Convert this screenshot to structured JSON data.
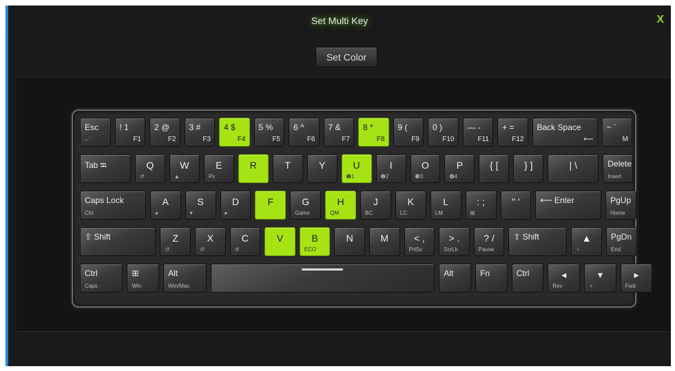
{
  "window": {
    "title": "Set Multi Key",
    "close_label": "X",
    "set_color_label": "Set Color"
  },
  "colors": {
    "accent_green": "#a6e315",
    "window_border_blue": "#1f86d6"
  },
  "keyboard": {
    "rows": [
      [
        {
          "main": "Esc",
          "alt": "~ `"
        },
        {
          "main": "! 1",
          "sub": "F1"
        },
        {
          "main": "2 @",
          "sub": "F2"
        },
        {
          "main": "3 #",
          "sub": "F3"
        },
        {
          "main": "4 $",
          "sub": "F4",
          "lit": true
        },
        {
          "main": "5 %",
          "sub": "F5"
        },
        {
          "main": "6 ^",
          "sub": "F6"
        },
        {
          "main": "7 &",
          "sub": "F7"
        },
        {
          "main": "8 *",
          "sub": "F8",
          "lit": true
        },
        {
          "main": "9 (",
          "sub": "F9"
        },
        {
          "main": "0 )",
          "sub": "F10"
        },
        {
          "main": "— -",
          "sub": "F11"
        },
        {
          "main": "+ =",
          "sub": "F12"
        },
        {
          "main": "Back Space",
          "sub": "⟵",
          "wide": 2
        },
        {
          "main": "~ `",
          "sub": "M"
        }
      ],
      [
        {
          "main": "Tab ⭾",
          "wide": 1.6
        },
        {
          "center": "Q",
          "alt": "↺"
        },
        {
          "center": "W",
          "alt": "▲"
        },
        {
          "center": "E",
          "alt": "Px"
        },
        {
          "center": "R",
          "lit": true
        },
        {
          "center": "T"
        },
        {
          "center": "Y"
        },
        {
          "center": "U",
          "alt": "❶1",
          "lit": true
        },
        {
          "center": "I",
          "alt": "❷2"
        },
        {
          "center": "O",
          "alt": "❸3"
        },
        {
          "center": "P",
          "alt": "❹4"
        },
        {
          "center": "{ ["
        },
        {
          "center": "} ]"
        },
        {
          "center": "| \\",
          "wide": 1.6
        },
        {
          "main": "Delete",
          "alt": "Insert"
        }
      ],
      [
        {
          "main": "Caps Lock",
          "alt": "Ctrl",
          "wide": 2
        },
        {
          "center": "A",
          "alt": "◂"
        },
        {
          "center": "S",
          "alt": "▾"
        },
        {
          "center": "D",
          "alt": "▸"
        },
        {
          "center": "F",
          "lit": true
        },
        {
          "center": "G",
          "alt": "Game"
        },
        {
          "center": "H",
          "alt": "QM",
          "lit": true
        },
        {
          "center": "J",
          "alt": "BC"
        },
        {
          "center": "K",
          "alt": "LC"
        },
        {
          "center": "L",
          "alt": "LM"
        },
        {
          "center": ": ;",
          "alt": "⊞"
        },
        {
          "center": "\" '"
        },
        {
          "main": "⟵ Enter",
          "wide": 2
        },
        {
          "main": "PgUp",
          "alt": "Home"
        }
      ],
      [
        {
          "main": "⇧ Shift",
          "wide": 2.3
        },
        {
          "center": "Z",
          "alt": "↺"
        },
        {
          "center": "X",
          "alt": "↺"
        },
        {
          "center": "C",
          "alt": "↺"
        },
        {
          "center": "V",
          "lit": true
        },
        {
          "center": "B",
          "alt": "ECO",
          "lit": true
        },
        {
          "center": "N"
        },
        {
          "center": "M"
        },
        {
          "center": "< ,",
          "alt": "PrtSc"
        },
        {
          "center": "> .",
          "alt": "ScrLk"
        },
        {
          "center": "? /",
          "alt": "Pause"
        },
        {
          "main": "⇧ Shift",
          "wide": 1.8
        },
        {
          "center": "▲",
          "alt": "♀"
        },
        {
          "main": "PgDn",
          "alt": "End"
        }
      ],
      [
        {
          "main": "Ctrl",
          "alt": "Caps",
          "wide": 1.3
        },
        {
          "main": "⊞",
          "alt": "Win"
        },
        {
          "main": "Alt",
          "alt": "Win/Mac",
          "wide": 1.3
        },
        {
          "space": true,
          "wide": 6.3
        },
        {
          "main": "Alt"
        },
        {
          "main": "Fn"
        },
        {
          "main": "Ctrl"
        },
        {
          "center": "◂",
          "alt": "Rev"
        },
        {
          "center": "▾",
          "alt": "♀"
        },
        {
          "center": "▸",
          "alt": "Fwd"
        }
      ]
    ]
  }
}
